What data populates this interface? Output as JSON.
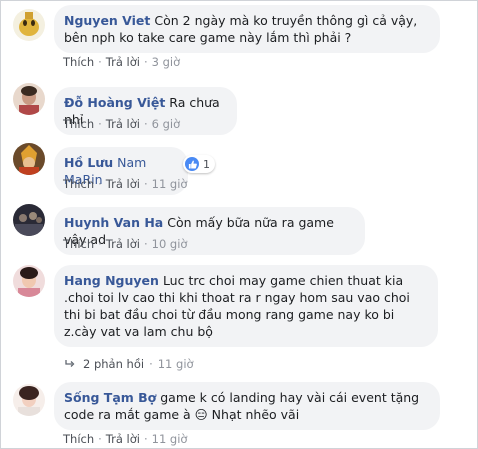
{
  "comments": [
    {
      "author": "Nguyen Viet",
      "text": "Còn 2 ngày mà ko truyền thông gì cả vậy, bên nph ko take care game này lắm thì phải ?",
      "like": "Thích",
      "reply": "Trả lời",
      "time": "3 giờ",
      "avatar_color": "#d8b24a"
    },
    {
      "author": "Đỗ Hoàng Việt",
      "text": "Ra chưa nhỉ",
      "like": "Thích",
      "reply": "Trả lời",
      "time": "6 giờ",
      "avatar_color": "#c49a8a"
    },
    {
      "author": "Hồ Lưu",
      "text": "Nam MaRin",
      "like": "Thích",
      "reply": "Trả lời",
      "time": "11 giờ",
      "reaction_count": "1",
      "avatar_color": "#b07a2c"
    },
    {
      "author": "Huynh Van Ha",
      "text": "Còn mấy bữa nữa ra game vậy ad",
      "like": "Thích",
      "reply": "Trả lời",
      "time": "10 giờ",
      "avatar_color": "#3a3a4a"
    },
    {
      "author": "Hang Nguyen",
      "text": "Luc trc choi may game chien thuat kia .choi toi lv cao thi khi thoat ra r ngay hom sau vao choi thi bi bat đầu choi từ đầu mong rang game nay ko bi z.cày vat va lam chu bộ",
      "replies_label": "2 phản hồi",
      "replies_time": "11 giờ",
      "avatar_color": "#d9a0a8"
    },
    {
      "author": "Sống Tạm Bợ",
      "text": "game k có landing hay vài cái event tặng code ra mắt game à 😑 Nhạt nhẽo vãi",
      "like": "Thích",
      "reply": "Trả lời",
      "time": "11 giờ",
      "avatar_color": "#e6c8c0"
    }
  ],
  "separator": "·",
  "colors": {
    "author": "#385898",
    "bubble_bg": "#f2f3f5",
    "like_blue": "#4a8af4"
  }
}
